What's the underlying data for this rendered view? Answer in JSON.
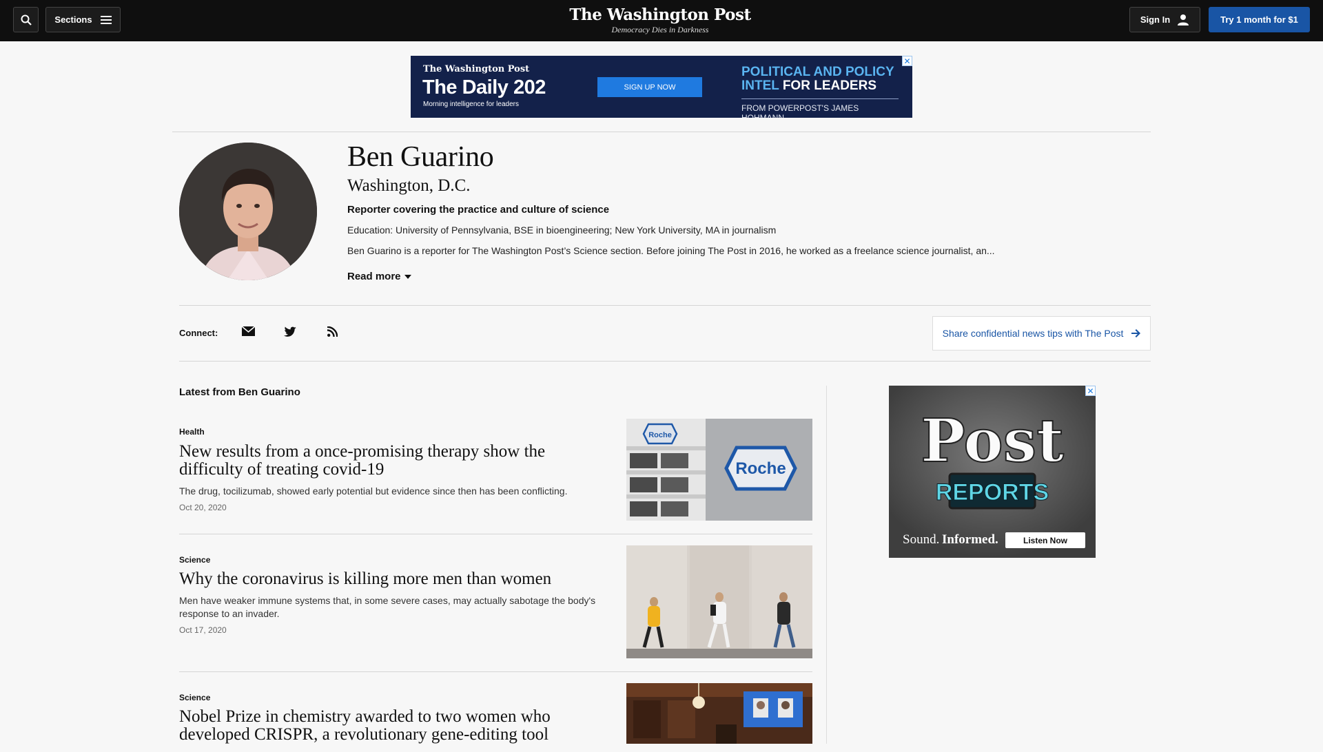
{
  "header": {
    "sections_label": "Sections",
    "logo_name": "The Washington Post",
    "logo_tagline": "Democracy Dies in Darkness",
    "signin_label": "Sign In",
    "trial_label": "Try 1 month for $1"
  },
  "top_ad": {
    "brand": "The Washington Post",
    "headline": "The Daily 202",
    "subline": "Morning intelligence for leaders",
    "cta": "SIGN UP NOW",
    "right_line1": "POLITICAL AND POLICY",
    "right_line2a": "INTEL",
    "right_line2b": "FOR LEADERS",
    "right_line3": "FROM POWERPOST'S JAMES HOHMANN",
    "close": "✕"
  },
  "author": {
    "name": "Ben Guarino",
    "location": "Washington, D.C.",
    "role": "Reporter covering the practice and culture of science",
    "education": "Education: University of Pennsylvania, BSE in bioengineering; New York University, MA in journalism",
    "bio": "Ben Guarino is a reporter for The Washington Post’s Science section. Before joining The Post in 2016, he worked as a freelance science journalist, an...",
    "read_more": "Read more"
  },
  "connect": {
    "label": "Connect:",
    "icons": [
      "email-icon",
      "twitter-icon",
      "rss-icon"
    ],
    "tips_label": "Share confidential news tips with The Post"
  },
  "latest": {
    "title": "Latest from Ben Guarino",
    "stories": [
      {
        "kicker": "Health",
        "headline": "New results from a once-promising therapy show the difficulty of treating covid-19",
        "dek": "The drug, tocilizumab, showed early potential but evidence since then has been conflicting.",
        "date": "Oct 20, 2020"
      },
      {
        "kicker": "Science",
        "headline": "Why the coronavirus is killing more men than women",
        "dek": "Men have weaker immune systems that, in some severe cases, may actually sabotage the body's response to an invader.",
        "date": "Oct 17, 2020"
      },
      {
        "kicker": "Science",
        "headline": "Nobel Prize in chemistry awarded to two women who developed CRISPR, a revolutionary gene-editing tool",
        "dek": "",
        "date": ""
      }
    ]
  },
  "thumb1": {
    "sign_text": "Roche",
    "sign_small": "Roche"
  },
  "side_ad": {
    "title": "Post",
    "subtitle": "REPORTS",
    "tagline_a": "Sound.",
    "tagline_b": "Informed.",
    "cta": "Listen Now",
    "close": "✕"
  },
  "colors": {
    "accent": "#1955a5",
    "topbar": "#0f0f0f",
    "background": "#f7f7f7"
  }
}
